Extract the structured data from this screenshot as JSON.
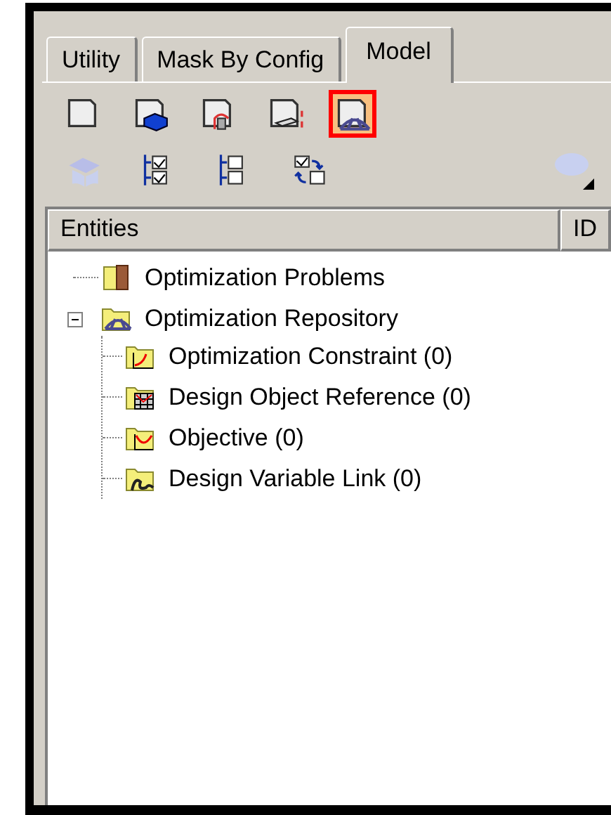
{
  "tabs": [
    {
      "label": "Utility",
      "selected": false
    },
    {
      "label": "Mask By Config",
      "selected": false
    },
    {
      "label": "Model",
      "selected": true
    }
  ],
  "toolbar_rows": [
    [
      {
        "kind": "page",
        "selected": false
      },
      {
        "kind": "solid",
        "selected": false
      },
      {
        "kind": "constraint",
        "selected": false
      },
      {
        "kind": "gap",
        "selected": false
      },
      {
        "kind": "bridge",
        "selected": true
      }
    ],
    [
      {
        "kind": "mesh"
      },
      {
        "kind": "checklist"
      },
      {
        "kind": "uncheck"
      },
      {
        "kind": "swap"
      }
    ]
  ],
  "table": {
    "columns": [
      "Entities",
      "ID"
    ]
  },
  "tree": [
    {
      "label": "Optimization Problems"
    },
    {
      "label": "Optimization Repository",
      "expanded": true,
      "children": [
        {
          "label": "Optimization Constraint (0)"
        },
        {
          "label": "Design Object Reference (0)"
        },
        {
          "label": "Objective (0)"
        },
        {
          "label": "Design Variable Link (0)"
        }
      ]
    }
  ]
}
